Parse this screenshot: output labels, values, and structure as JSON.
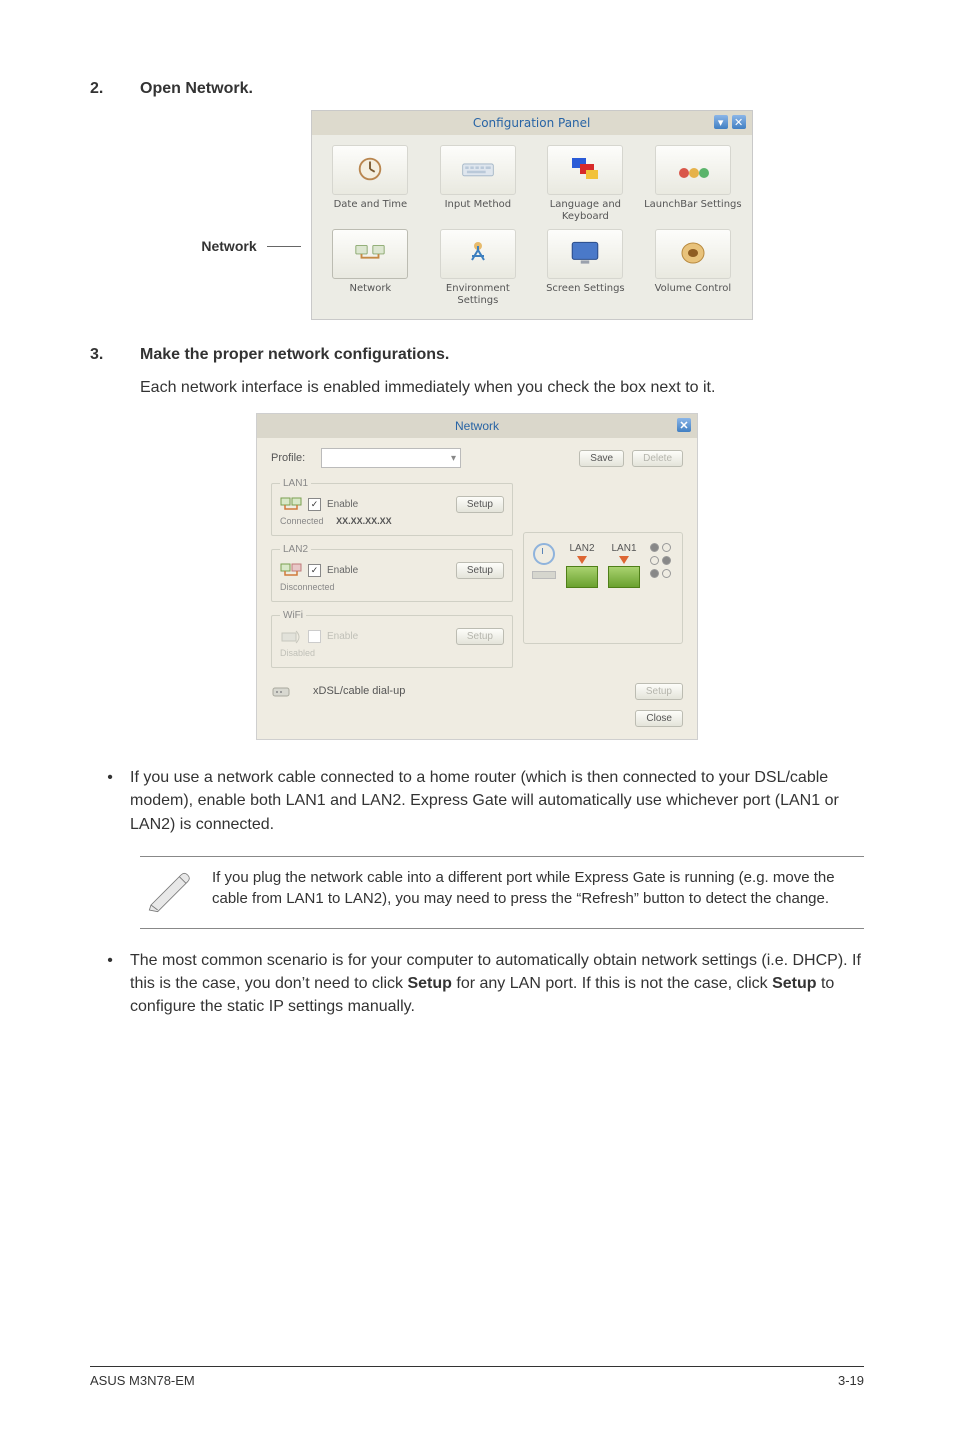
{
  "step2": {
    "num": "2.",
    "title": "Open Network."
  },
  "cp_label": "Network",
  "config_panel": {
    "title": "Configuration Panel",
    "items": [
      {
        "label": "Date and Time"
      },
      {
        "label": "Input Method"
      },
      {
        "label": "Language and Keyboard"
      },
      {
        "label": "LaunchBar Settings"
      },
      {
        "label": "Network"
      },
      {
        "label": "Environment Settings"
      },
      {
        "label": "Screen Settings"
      },
      {
        "label": "Volume Control"
      }
    ]
  },
  "step3": {
    "num": "3.",
    "title": "Make the proper network configurations.",
    "body": "Each network interface is enabled immediately when you check the box next to it."
  },
  "network_dlg": {
    "title": "Network",
    "profile_label": "Profile:",
    "save": "Save",
    "delete": "Delete",
    "lan1": {
      "legend": "LAN1",
      "enable": "Enable",
      "setup": "Setup",
      "status": "Connected",
      "ip": "XX.XX.XX.XX"
    },
    "lan2": {
      "legend": "LAN2",
      "enable": "Enable",
      "setup": "Setup",
      "status": "Disconnected"
    },
    "wifi": {
      "legend": "WiFi",
      "enable": "Enable",
      "setup": "Setup",
      "status": "Disabled"
    },
    "ports": {
      "lan2": "LAN2",
      "lan1": "LAN1"
    },
    "xdsl": {
      "label": "xDSL/cable dial-up",
      "setup": "Setup"
    },
    "close": "Close"
  },
  "bullet1": "If you use a network cable connected to a home router (which is then connected to your DSL/cable modem), enable both LAN1 and LAN2. Express Gate  will automatically use whichever port (LAN1 or LAN2) is connected.",
  "note": "If you plug the network cable into a different port while Express Gate  is running (e.g. move the cable from LAN1 to LAN2), you may need to press the “Refresh” button to detect the change.",
  "bullet2_pre": "The most common scenario is for your computer to automatically obtain network settings (i.e. DHCP). If this is the case, you don’t need to click ",
  "bullet2_setup1": "Setup",
  "bullet2_mid": " for any LAN port. If this is not the case, click ",
  "bullet2_setup2": "Setup",
  "bullet2_post": " to configure the static IP settings manually.",
  "footer": {
    "left": "ASUS M3N78-EM",
    "right": "3-19"
  }
}
